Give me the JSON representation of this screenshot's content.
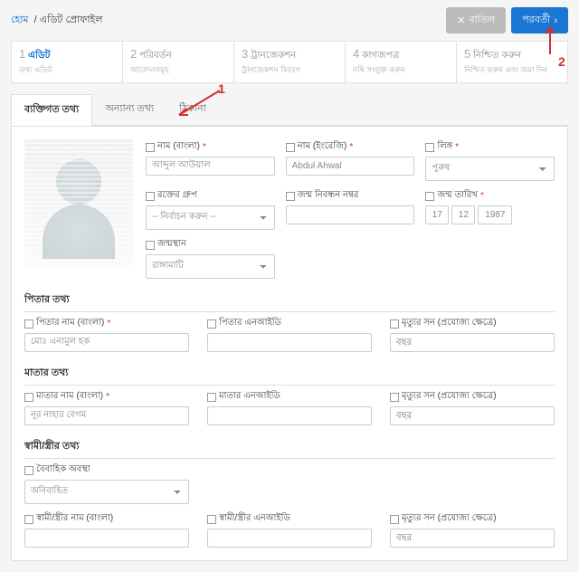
{
  "breadcrumb": {
    "home": "হোম",
    "current": "এডিট প্রোফাইল"
  },
  "actions": {
    "cancel": "বাতিল",
    "next": "পরবর্তী"
  },
  "steps": [
    {
      "num": "1",
      "title": "এডিট",
      "sub": "তথ্য এডিট"
    },
    {
      "num": "2",
      "title": "পরিবর্তন",
      "sub": "আবেদনসমূহ"
    },
    {
      "num": "3",
      "title": "ট্রানজেকশন",
      "sub": "ট্রানজেকশন বিবরণ"
    },
    {
      "num": "4",
      "title": "কাগজপত্র",
      "sub": "নথি সংযুক্ত করুন"
    },
    {
      "num": "5",
      "title": "নিশ্চিত করুন",
      "sub": "নিশ্চিত করুন এবং জমা দিন"
    }
  ],
  "tabs": [
    "ব্যক্তিগত তথ্য",
    "অন্যান্য তথ্য",
    "ঠিকানা"
  ],
  "personal": {
    "name_bn": {
      "label": "নাম (বাংলা)",
      "value": "আব্দুল আউয়াল"
    },
    "name_en": {
      "label": "নাম (ইংরেজি)",
      "value": "Abdul Ahwal"
    },
    "gender": {
      "label": "লিঙ্গ",
      "value": "পুরুষ"
    },
    "blood": {
      "label": "রক্তের গ্রুপ",
      "value": "-- নির্বাচন করুন --"
    },
    "birth_reg": {
      "label": "জন্ম নিবন্ধন নম্বর",
      "value": ""
    },
    "dob": {
      "label": "জন্ম তারিখ",
      "d": "17",
      "m": "12",
      "y": "1987"
    },
    "birthplace": {
      "label": "জন্মস্থান",
      "value": "রাঙ্গামাটি"
    }
  },
  "father": {
    "title": "পিতার তথ্য",
    "name": {
      "label": "পিতার নাম (বাংলা)",
      "value": "মোঃ এনামুল হক"
    },
    "nid": {
      "label": "পিতার এনআইডি",
      "value": ""
    },
    "death": {
      "label": "মৃত্যুর সন (প্রযোজ্য ক্ষেত্রে)",
      "value": "বছর"
    }
  },
  "mother": {
    "title": "মাতার তথ্য",
    "name": {
      "label": "মাতার নাম (বাংলা)",
      "value": "নূর নাহার বেগম"
    },
    "nid": {
      "label": "মাতার এনআইডি",
      "value": ""
    },
    "death": {
      "label": "মৃত্যুর সন (প্রযোজ্য ক্ষেত্রে)",
      "value": "বছর"
    }
  },
  "spouse": {
    "title": "স্বামী/স্ত্রীর তথ্য",
    "marital": {
      "label": "বৈবাহিক অবস্থা",
      "value": "অবিবাহিত"
    },
    "name": {
      "label": "স্বামী/স্ত্রীর নাম (বাংলা)",
      "value": ""
    },
    "nid": {
      "label": "স্বামী/স্ত্রীর এনআইডি",
      "value": ""
    },
    "death": {
      "label": "মৃত্যুর সন (প্রযোজ্য ক্ষেত্রে)",
      "value": "বছর"
    }
  },
  "annotations": {
    "one": "1",
    "two": "2"
  }
}
